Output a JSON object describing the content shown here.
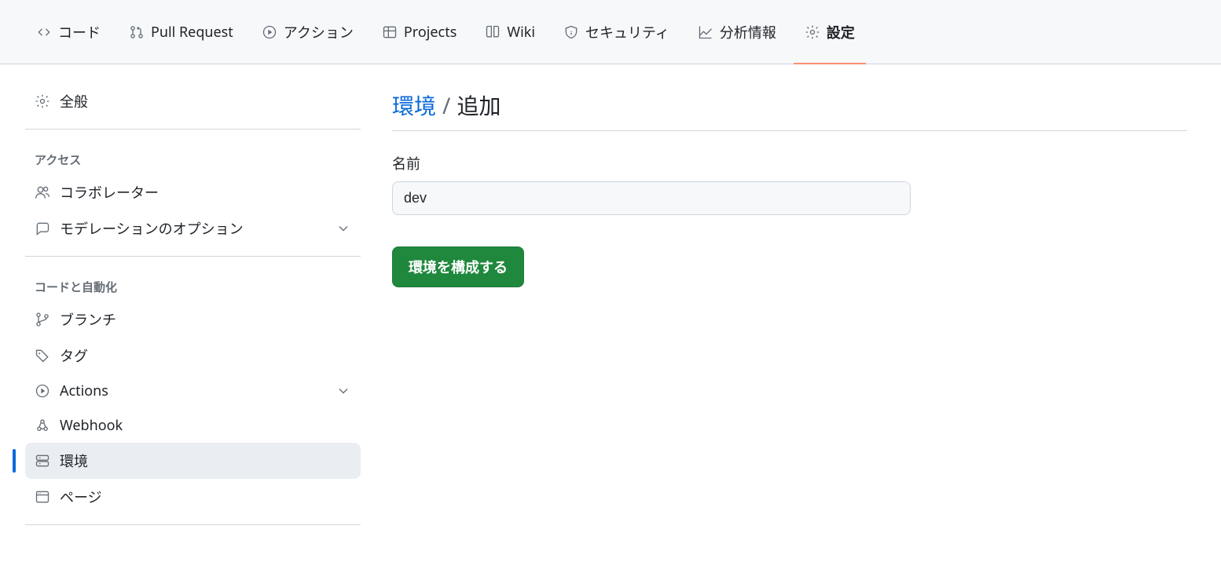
{
  "topnav": [
    {
      "id": "code",
      "label": "コード"
    },
    {
      "id": "pr",
      "label": "Pull Request"
    },
    {
      "id": "actions",
      "label": "アクション"
    },
    {
      "id": "projects",
      "label": "Projects"
    },
    {
      "id": "wiki",
      "label": "Wiki"
    },
    {
      "id": "security",
      "label": "セキュリティ"
    },
    {
      "id": "insights",
      "label": "分析情報"
    },
    {
      "id": "settings",
      "label": "設定"
    }
  ],
  "sidebar": {
    "general": "全般",
    "section_access": "アクセス",
    "collaborators": "コラボレーター",
    "moderation": "モデレーションのオプション",
    "section_code": "コードと自動化",
    "branches": "ブランチ",
    "tags": "タグ",
    "actions": "Actions",
    "webhooks": "Webhook",
    "environments": "環境",
    "pages": "ページ"
  },
  "breadcrumb": {
    "root": "環境",
    "sep": "/",
    "current": "追加"
  },
  "form": {
    "name_label": "名前",
    "name_value": "dev",
    "submit": "環境を構成する"
  }
}
